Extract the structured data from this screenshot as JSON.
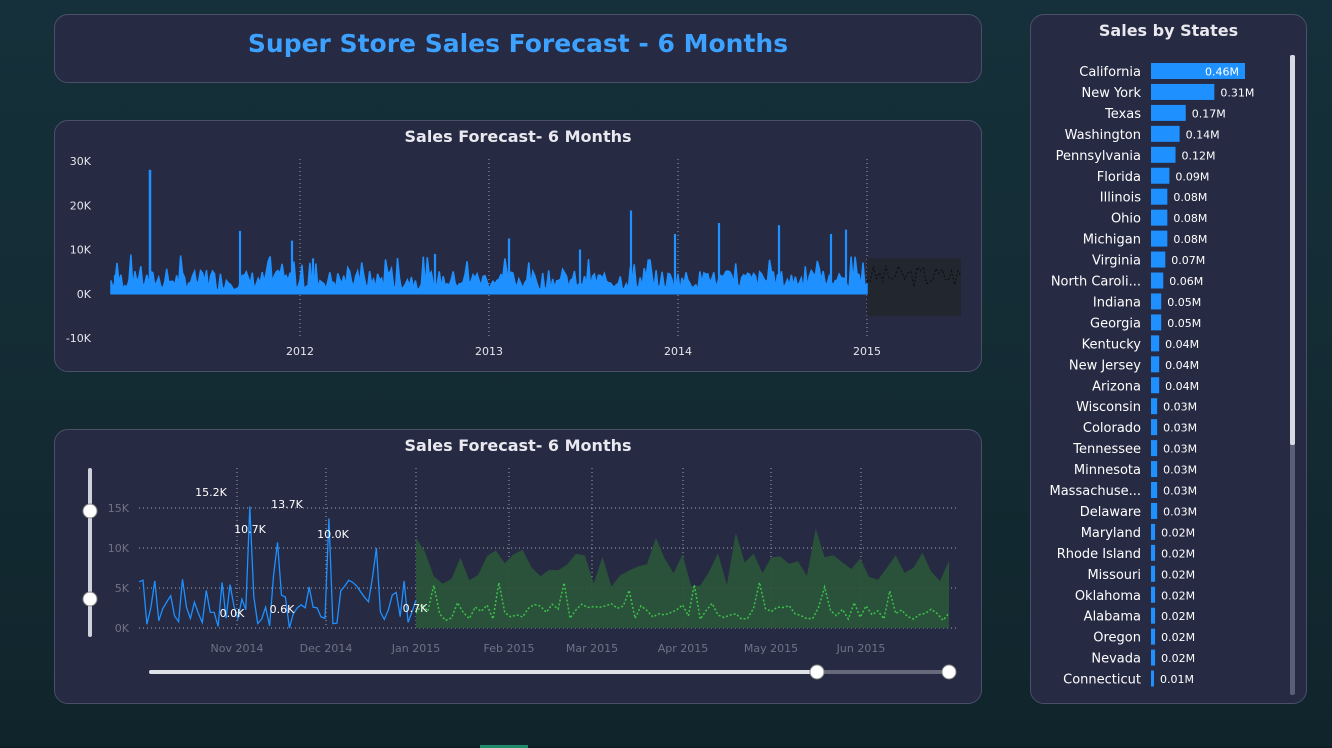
{
  "header": {
    "title": "Super Store Sales Forecast - 6 Months"
  },
  "colors": {
    "accent": "#1e90ff",
    "forecast_band": "#2c5a3a",
    "forecast_line": "#3cc24a",
    "bar": "#1e90ff"
  },
  "chart_data": [
    {
      "type": "line",
      "title": "Sales Forecast- 6 Months",
      "xlabel": "",
      "ylabel": "",
      "ylim": [
        -10000,
        30000
      ],
      "y_ticks": [
        "30K",
        "20K",
        "10K",
        "0K",
        "-10K"
      ],
      "x_ticks": [
        "2012",
        "2013",
        "2014",
        "2015"
      ],
      "xlim": [
        "2011-01",
        "2015-07"
      ],
      "grid": "vertical dotted",
      "series": [
        {
          "values": [
            4200,
            28000,
            14200,
            12000,
            8000,
            9000,
            12500,
            10000,
            18800,
            13500,
            16000,
            15500,
            13500,
            14500
          ]
        },
        {
          "values": [
            2500,
            4200,
            6000,
            5000,
            5500,
            8000
          ]
        }
      ]
    },
    {
      "type": "line",
      "title": "Sales Forecast- 6 Months",
      "xlabel": "",
      "ylabel": "",
      "ylim": [
        0,
        15000
      ],
      "y_ticks": [
        "15K",
        "10K",
        "5K",
        "0K"
      ],
      "x_ticks": [
        "Nov 2014",
        "Dec 2014",
        "Jan 2015",
        "Feb 2015",
        "Mar 2015",
        "Apr 2015",
        "May 2015",
        "Jun 2015"
      ],
      "data_labels": [
        "15.2K",
        "10.7K",
        "0.0K",
        "13.7K",
        "0.6K",
        "10.0K",
        "0.7K"
      ],
      "grid": "dotted",
      "series": [
        {
          "values": [
            15200,
            10700,
            0,
            13700,
            600,
            10000,
            700
          ]
        },
        {
          "values": [
            1500,
            4200,
            2800,
            3500,
            2600,
            2200,
            3000,
            2000
          ]
        }
      ]
    },
    {
      "type": "bar",
      "title": "Sales by States",
      "categories": [
        "California",
        "New York",
        "Texas",
        "Washington",
        "Pennsylvania",
        "Florida",
        "Illinois",
        "Ohio",
        "Michigan",
        "Virginia",
        "North Caroli...",
        "Indiana",
        "Georgia",
        "Kentucky",
        "New Jersey",
        "Arizona",
        "Wisconsin",
        "Colorado",
        "Tennessee",
        "Minnesota",
        "Massachuse...",
        "Delaware",
        "Maryland",
        "Rhode Island",
        "Missouri",
        "Oklahoma",
        "Alabama",
        "Oregon",
        "Nevada",
        "Connecticut"
      ],
      "values": [
        0.46,
        0.31,
        0.17,
        0.14,
        0.12,
        0.09,
        0.08,
        0.08,
        0.08,
        0.07,
        0.06,
        0.05,
        0.05,
        0.04,
        0.04,
        0.04,
        0.03,
        0.03,
        0.03,
        0.03,
        0.03,
        0.03,
        0.02,
        0.02,
        0.02,
        0.02,
        0.02,
        0.02,
        0.02,
        0.01
      ],
      "labels": [
        "0.46M",
        "0.31M",
        "0.17M",
        "0.14M",
        "0.12M",
        "0.09M",
        "0.08M",
        "0.08M",
        "0.08M",
        "0.07M",
        "0.06M",
        "0.05M",
        "0.05M",
        "0.04M",
        "0.04M",
        "0.04M",
        "0.03M",
        "0.03M",
        "0.03M",
        "0.03M",
        "0.03M",
        "0.03M",
        "0.02M",
        "0.02M",
        "0.02M",
        "0.02M",
        "0.02M",
        "0.02M",
        "0.02M",
        "0.01M"
      ]
    }
  ]
}
